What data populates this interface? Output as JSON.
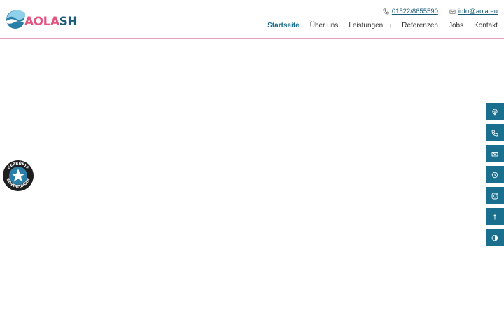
{
  "brand": {
    "logo_part1": "AOLA",
    "logo_part2": "SH",
    "colors": {
      "pink": "#e2557f",
      "blue": "#1a5c7a",
      "accent": "#1a6f8e"
    }
  },
  "contact": {
    "phone": "01522/8655590",
    "email": "info@aola.eu",
    "phone_icon": "phone-icon",
    "email_icon": "mail-icon"
  },
  "nav": {
    "items": [
      {
        "label": "Startseite",
        "active": true
      },
      {
        "label": "Über uns"
      },
      {
        "label": "Leistungen",
        "has_dropdown": true
      },
      {
        "label": "Referenzen"
      },
      {
        "label": "Jobs"
      },
      {
        "label": "Kontakt"
      }
    ]
  },
  "sidebar": {
    "buttons": [
      {
        "icon": "location-pin-icon"
      },
      {
        "icon": "phone-icon"
      },
      {
        "icon": "mail-icon"
      },
      {
        "icon": "clock-icon"
      },
      {
        "icon": "instagram-icon"
      },
      {
        "icon": "arrow-up-icon"
      },
      {
        "icon": "contrast-icon"
      }
    ]
  },
  "badge": {
    "text_top": "GEPRÜFTE",
    "text_bottom": "BEWERTUNGEN"
  }
}
